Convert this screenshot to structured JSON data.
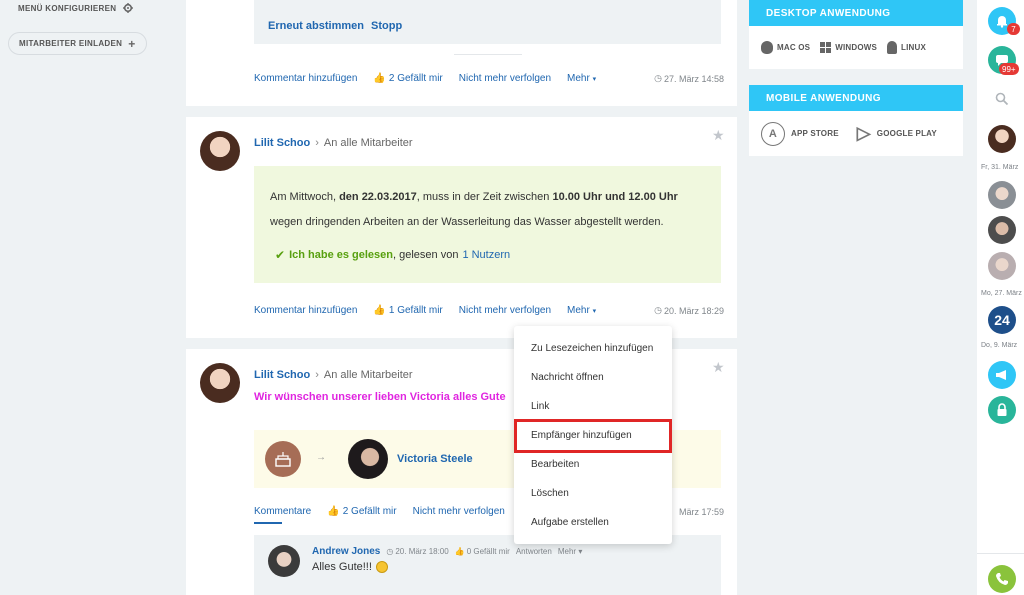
{
  "left_menu": {
    "configure_label": "MENÜ KONFIGURIEREN",
    "invite_label": "MITARBEITER EINLADEN"
  },
  "post1": {
    "vote_again": "Erneut abstimmen",
    "stop": "Stopp",
    "actions": {
      "comment": "Kommentar hinzufügen",
      "likes": "2 Gefällt mir",
      "unfollow": "Nicht mehr verfolgen",
      "more": "Mehr",
      "timestamp": "27. März 14:58"
    }
  },
  "post2": {
    "author": "Lilit Schoo",
    "recipient": "An alle Mitarbeiter",
    "body_pre": "Am Mittwoch,",
    "body_date": "den 22.03.2017",
    "body_mid": ", muss in der Zeit zwischen",
    "body_time1": "10.00 Uhr",
    "body_und": "und",
    "body_time2": "12.00 Uhr",
    "body_line2": "wegen dringenden Arbeiten an der Wasserleitung das Wasser abgestellt werden.",
    "read_label": "Ich habe es gelesen",
    "read_by": ", gelesen von",
    "read_count": "1 Nutzern",
    "actions": {
      "comment": "Kommentar hinzufügen",
      "likes": "1 Gefällt mir",
      "unfollow": "Nicht mehr verfolgen",
      "more": "Mehr",
      "timestamp": "20. März 18:29"
    }
  },
  "post3": {
    "author": "Lilit Schoo",
    "recipient": "An alle Mitarbeiter",
    "greeting": "Wir wünschen unserer lieben Victoria alles Gute",
    "honoree": "Victoria Steele",
    "actions": {
      "comments": "Kommentare",
      "likes": "2 Gefällt mir",
      "unfollow": "Nicht mehr verfolgen",
      "timestamp": "März 17:59"
    },
    "comment": {
      "author": "Andrew Jones",
      "timestamp": "20. März 18:00",
      "likes": "0 Gefällt mir",
      "reply": "Antworten",
      "more": "Mehr",
      "text": "Alles Gute!!!"
    }
  },
  "dropdown": {
    "items": [
      "Zu Lesezeichen hinzufügen",
      "Nachricht öffnen",
      "Link",
      "Empfänger hinzufügen",
      "Bearbeiten",
      "Löschen",
      "Aufgabe erstellen"
    ]
  },
  "right": {
    "desktop_title": "DESKTOP ANWENDUNG",
    "mac": "MAC OS",
    "windows": "WINDOWS",
    "linux": "LINUX",
    "mobile_title": "MOBILE ANWENDUNG",
    "appstore": "APP STORE",
    "googleplay": "GOOGLE PLAY"
  },
  "dock": {
    "notif_count": "7",
    "chat_count": "99+",
    "date1": "Fr, 31. März",
    "date2": "Mo, 27. März",
    "date3": "Do, 9. März",
    "badge24": "24"
  },
  "colors": {
    "accent": "#2fc6f6",
    "link": "#2067b0",
    "highlight": "#e02626",
    "greeting": "#e025e0",
    "read_green": "#58a00f"
  }
}
